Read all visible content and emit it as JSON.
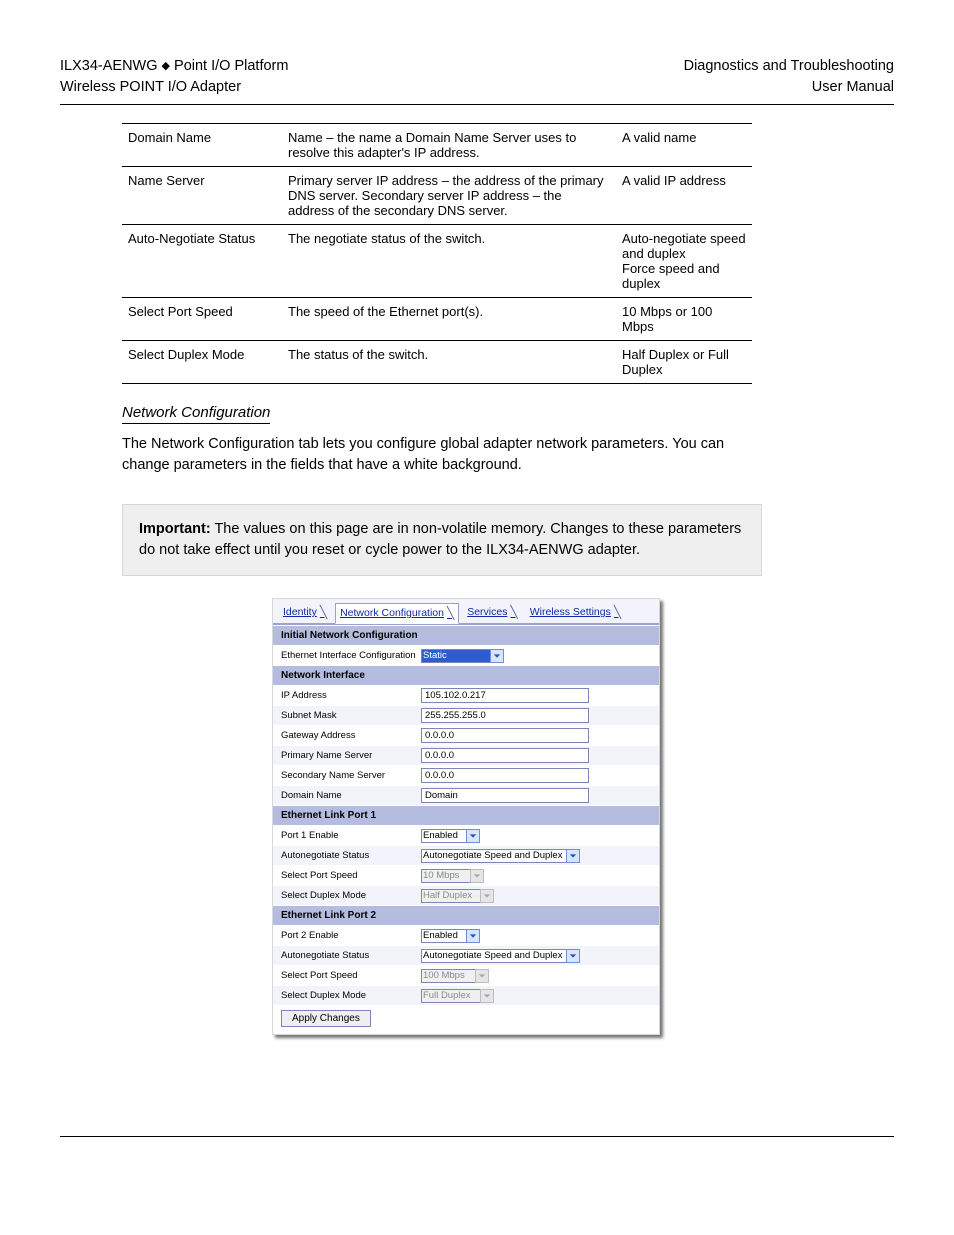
{
  "header": {
    "left_line1_a": "ILX34-AENWG",
    "left_line1_b": "Point I/O Platform",
    "left_line2": "Wireless POINT I/O Adapter",
    "right_line1": "Diagnostics and Troubleshooting",
    "right_line2": "User Manual"
  },
  "spec_rows": [
    {
      "a": "Domain Name",
      "b": "Name – the name a Domain Name Server uses to resolve this adapter's IP address.",
      "c": "A valid name"
    },
    {
      "a": "Name Server",
      "b": "Primary server IP address – the address of the primary DNS server. Secondary server IP address – the address of the secondary DNS server.",
      "c": "A valid IP address"
    },
    {
      "a": "Auto-Negotiate Status",
      "b": "The negotiate status of the switch.",
      "c": "Auto-negotiate speed and duplex\nForce speed and duplex"
    },
    {
      "a": "Select Port Speed",
      "b": "The speed of the Ethernet port(s).",
      "c": "10 Mbps or 100 Mbps"
    },
    {
      "a": "Select Duplex Mode",
      "b": "The status of the switch.",
      "c": "Half Duplex or Full Duplex"
    }
  ],
  "section_heading": "Network Configuration",
  "section_body": "The Network Configuration tab lets you configure global adapter network parameters. You can change parameters in the fields that have a white background.",
  "important": {
    "label": "Important:",
    "text": " The values on this page are in non-volatile memory. Changes to these parameters do not take effect until you reset or cycle power to the ILX34-AENWG adapter."
  },
  "ui": {
    "tabs": {
      "identity": "Identity",
      "network": "Network Configuration",
      "services": "Services",
      "wireless": "Wireless Settings"
    },
    "headers": {
      "initial": "Initial Network Configuration",
      "iface": "Network Interface",
      "port1": "Ethernet Link Port 1",
      "port2": "Ethernet Link Port 2"
    },
    "labels": {
      "eic": "Ethernet Interface Configuration",
      "ip": "IP Address",
      "subnet": "Subnet Mask",
      "gateway": "Gateway Address",
      "pns": "Primary Name Server",
      "sns": "Secondary Name Server",
      "domain": "Domain Name",
      "p1_enable": "Port 1  Enable",
      "p2_enable": "Port 2  Enable",
      "autoneg": "Autonegotiate Status",
      "speed": "Select Port Speed",
      "duplex": "Select Duplex Mode"
    },
    "values": {
      "eic": "Static",
      "ip": "105.102.0.217",
      "subnet": "255.255.255.0",
      "gateway": "0.0.0.0",
      "pns": "0.0.0.0",
      "sns": "0.0.0.0",
      "domain": "Domain",
      "enabled": "Enabled",
      "autoneg": "Autonegotiate Speed and Duplex",
      "speed10": "10 Mbps",
      "speed100": "100 Mbps",
      "half": "Half Duplex",
      "full": "Full Duplex"
    },
    "apply": "Apply Changes"
  }
}
